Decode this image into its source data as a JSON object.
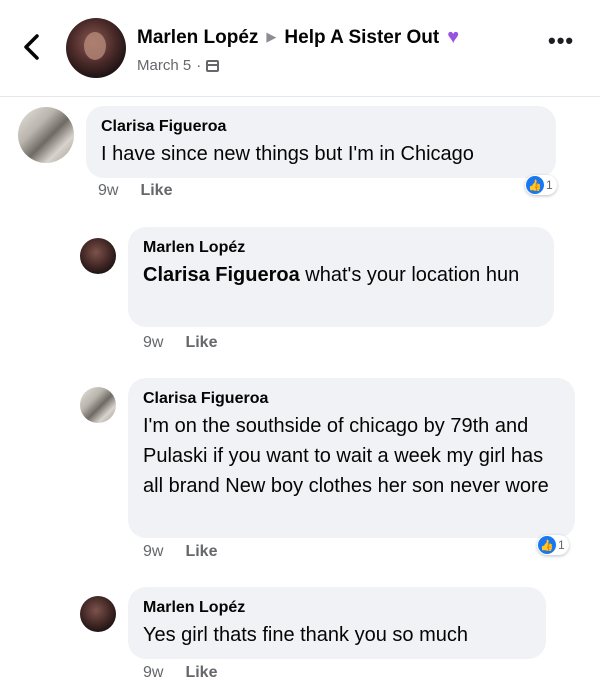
{
  "header": {
    "author": "Marlen Lopéz",
    "group": "Help A Sister Out",
    "date": "March 5",
    "separator": "·",
    "icons": {
      "back": "back-chevron-icon",
      "arrow": "triangle-right-icon",
      "heart": "purple-heart-icon",
      "privacy": "calendar-icon",
      "more": "more-dots-icon"
    }
  },
  "comments": [
    {
      "author": "Clarisa Figueroa",
      "mention": "",
      "text": "I have since new things but I'm in Chicago",
      "time": "9w",
      "like": "Like",
      "reactions": "1"
    },
    {
      "author": "Marlen Lopéz",
      "mention": "Clarisa Figueroa",
      "text": " what's your location hun",
      "time": "9w",
      "like": "Like",
      "reactions": ""
    },
    {
      "author": "Clarisa Figueroa",
      "mention": "",
      "text": "I'm on the southside of chicago by 79th and Pulaski if you want to wait a week my girl has all brand New boy clothes her son never wore",
      "time": "9w",
      "like": "Like",
      "reactions": "1"
    },
    {
      "author": "Marlen Lopéz",
      "mention": "",
      "text": "Yes girl thats fine thank you so much",
      "time": "9w",
      "like": "Like",
      "reactions": ""
    }
  ],
  "colors": {
    "bubble": "#f0f2f5",
    "like_blue": "#1877f2",
    "heart": "#9b51e0",
    "meta": "#65676b"
  }
}
